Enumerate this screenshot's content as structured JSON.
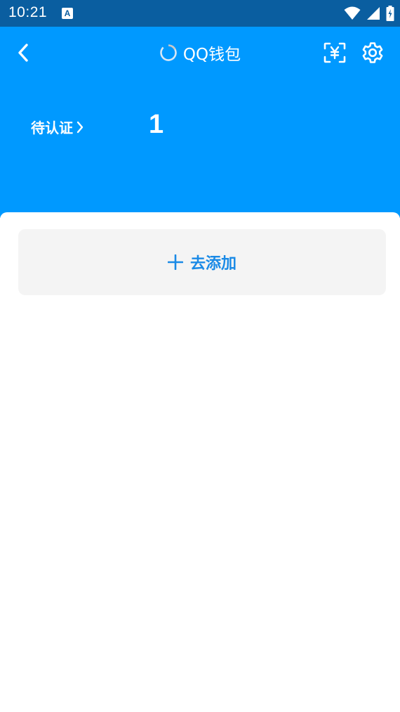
{
  "status_bar": {
    "time": "10:21",
    "app_icon_letter": "A",
    "icons": [
      "wifi-icon",
      "signal-icon",
      "battery-icon"
    ]
  },
  "header": {
    "title": "QQ钱包",
    "back_icon": "back-arrow-icon",
    "loading_icon": "loading-spinner-icon",
    "scan_icon": "yuan-scan-icon",
    "settings_icon": "gear-icon",
    "pending_label": "待认证",
    "pending_count": "1"
  },
  "main": {
    "add_label": "去添加",
    "add_icon": "plus-icon"
  },
  "colors": {
    "status_bar": "#0a5ea0",
    "header": "#0099ff",
    "card_bg": "#f4f4f4",
    "accent": "#1a8ae6"
  }
}
